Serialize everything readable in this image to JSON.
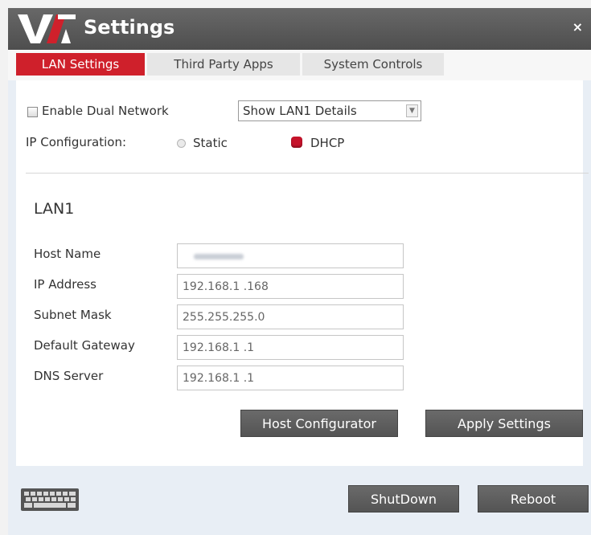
{
  "window": {
    "title": "Settings",
    "close_label": "×"
  },
  "tabs": [
    {
      "label": "LAN Settings",
      "active": true
    },
    {
      "label": "Third Party Apps",
      "active": false
    },
    {
      "label": "System Controls",
      "active": false
    }
  ],
  "network": {
    "dual_network_label": "Enable Dual Network",
    "dual_network_checked": false,
    "lan_select_value": "Show LAN1 Details",
    "ip_config_label": "IP Configuration:",
    "static_label": "Static",
    "dhcp_label": "DHCP",
    "selected_mode": "DHCP"
  },
  "lan1": {
    "section_title": "LAN1",
    "fields": [
      {
        "label": "Host Name",
        "value": ""
      },
      {
        "label": "IP Address",
        "value": "192.168.1  .168"
      },
      {
        "label": "Subnet Mask",
        "value": "255.255.255.0"
      },
      {
        "label": "Default Gateway",
        "value": "192.168.1  .1"
      },
      {
        "label": "DNS Server",
        "value": "192.168.1  .1"
      }
    ]
  },
  "actions": {
    "host_configurator": "Host Configurator",
    "apply_settings": "Apply Settings"
  },
  "footer": {
    "shutdown": "ShutDown",
    "reboot": "Reboot"
  },
  "icons": {
    "logo": "via-logo",
    "keyboard": "keyboard-icon"
  },
  "colors": {
    "accent": "#cf202b",
    "titlebar": "#555555",
    "button": "#5d5d5d"
  }
}
